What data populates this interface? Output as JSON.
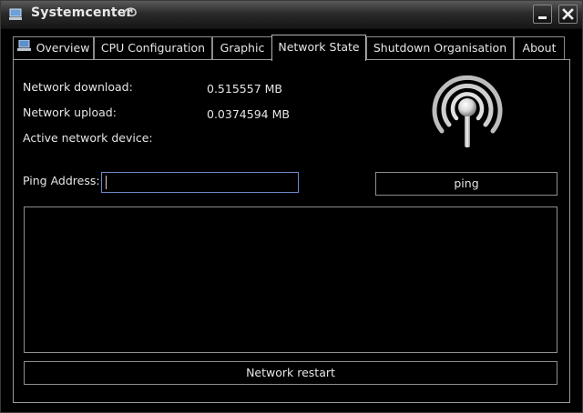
{
  "window": {
    "title": "Systemcenter"
  },
  "tabs": [
    {
      "label": "Overview"
    },
    {
      "label": "CPU Configuration"
    },
    {
      "label": "Graphic"
    },
    {
      "label": "Network State"
    },
    {
      "label": "Shutdown Organisation"
    },
    {
      "label": "About"
    }
  ],
  "network": {
    "download_label": "Network download:",
    "download_value": "0.515557 MB",
    "upload_label": "Network upload:",
    "upload_value": "0.0374594 MB",
    "device_label": "Active network device:",
    "ping_label": "Ping Address:",
    "ping_value": "",
    "ping_button": "ping",
    "restart_button": "Network restart"
  },
  "icons": {
    "app": "computer-icon",
    "title_decoration": "swirl-icon",
    "minimize": "minimize-icon",
    "close": "close-icon",
    "network_status": "wireless-signal-icon"
  },
  "colors": {
    "background": "#000000",
    "text": "#e6e6e6",
    "border": "#8e8e8e",
    "input_focus": "#6d88c7"
  }
}
